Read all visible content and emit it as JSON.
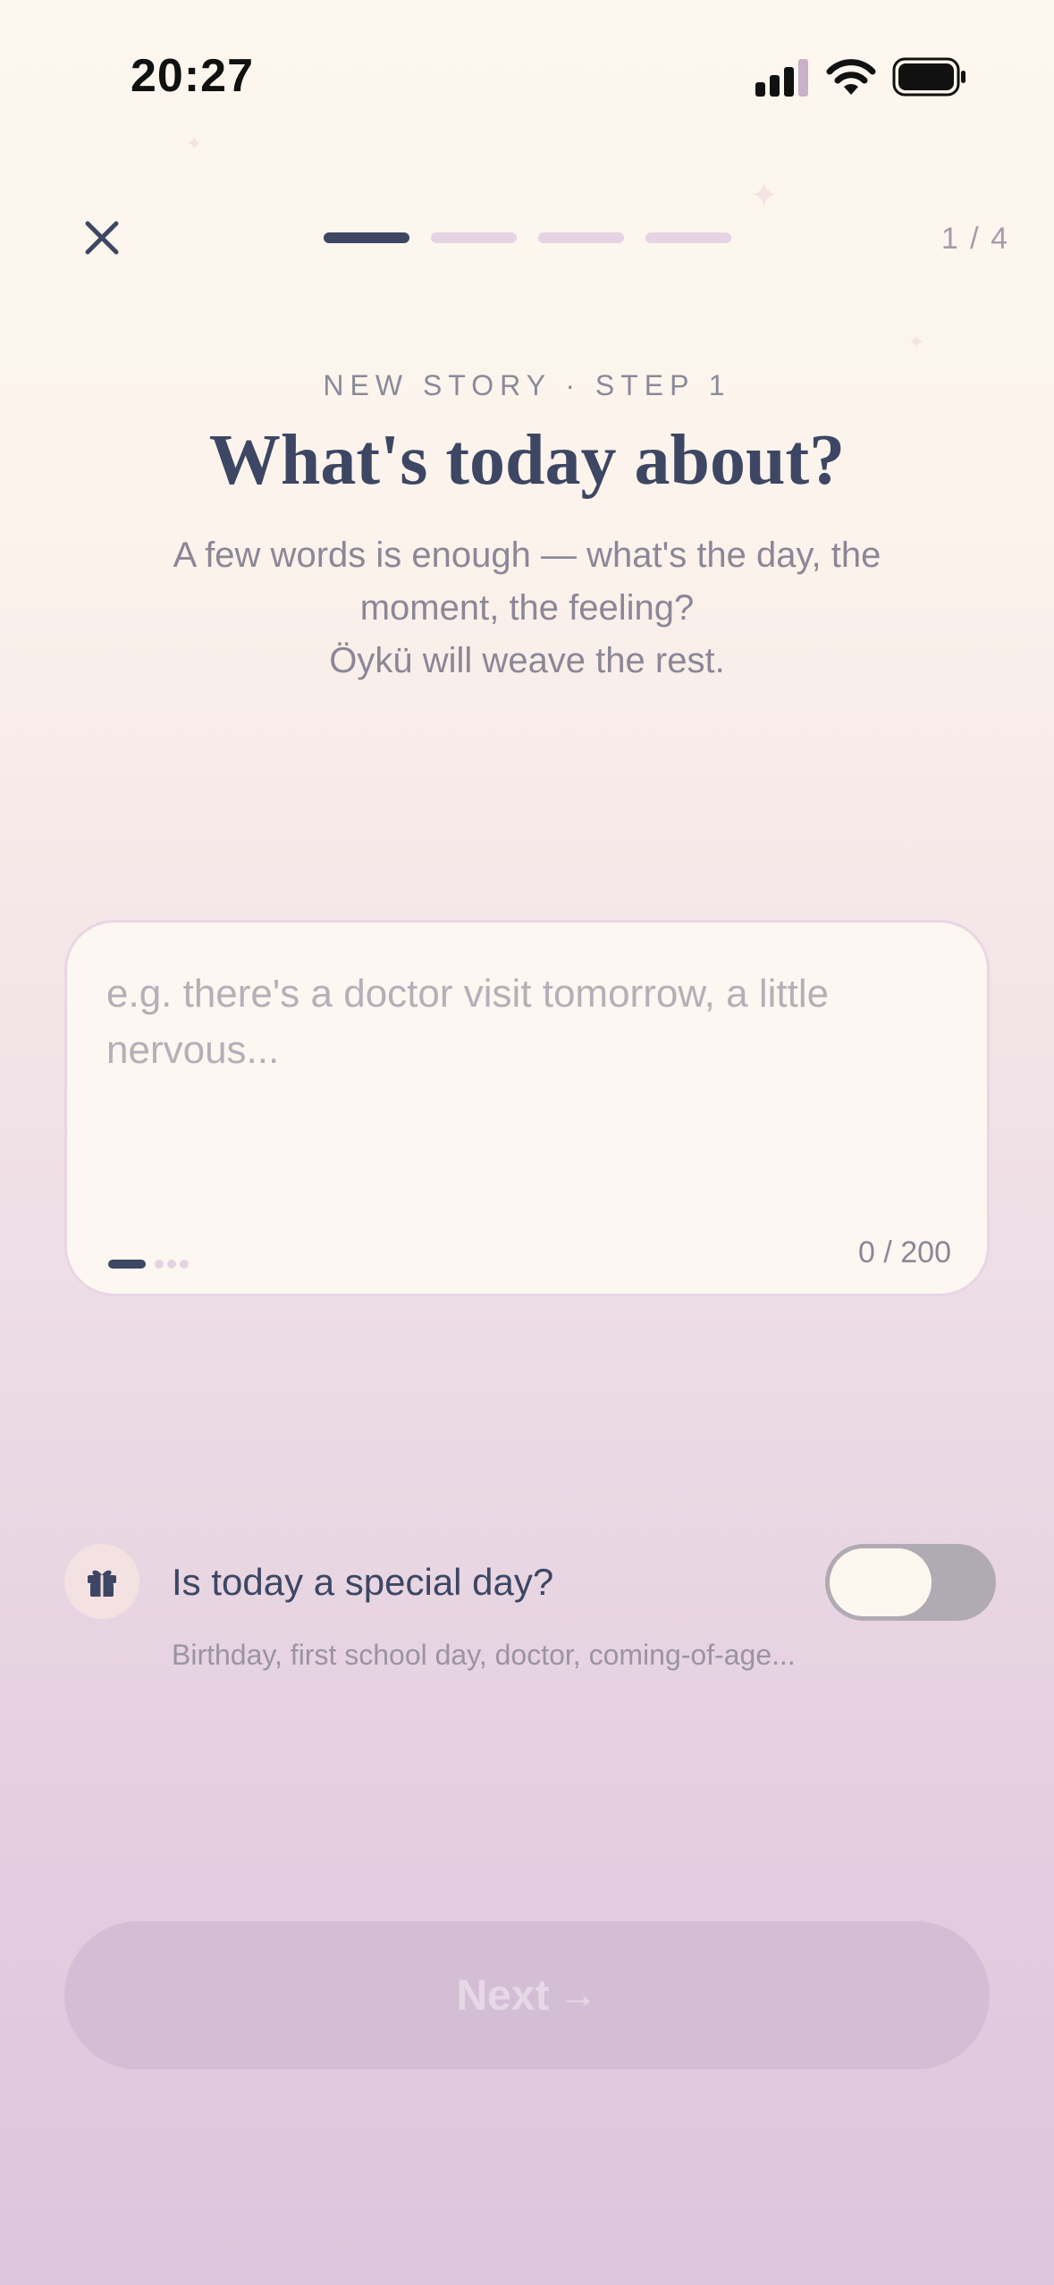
{
  "status_bar": {
    "time": "20:27",
    "icons": [
      "signal-icon",
      "wifi-icon",
      "battery-icon"
    ]
  },
  "header": {
    "close_icon": "close-icon",
    "progress": {
      "current_step": 1,
      "total_steps": 4
    },
    "step_counter": "1 / 4"
  },
  "intro": {
    "kicker": "NEW STORY · STEP 1",
    "title": "What's today about?",
    "subtitle_line1": "A few words is enough — what's the day, the",
    "subtitle_line2": "moment, the feeling?",
    "subtitle_line3": "Öykü will weave the rest."
  },
  "story_input": {
    "value": "",
    "placeholder": "e.g. there's a doctor visit tomorrow, a little nervous...",
    "char_count": "0 / 200",
    "hint_dots": {
      "count": 4,
      "active_index": 0
    }
  },
  "special_day": {
    "icon": "gift-icon",
    "label": "Is today a special day?",
    "hint": "Birthday, first school day, doctor, coming-of-age...",
    "toggle_on": false
  },
  "footer": {
    "next_label": "Next",
    "next_arrow": "→",
    "next_enabled": false
  },
  "colors": {
    "accent": "#3d4763",
    "progress_inactive": "#e6d3e3",
    "button_disabled": "#d4bed5",
    "toggle_off": "#b0aab3"
  }
}
